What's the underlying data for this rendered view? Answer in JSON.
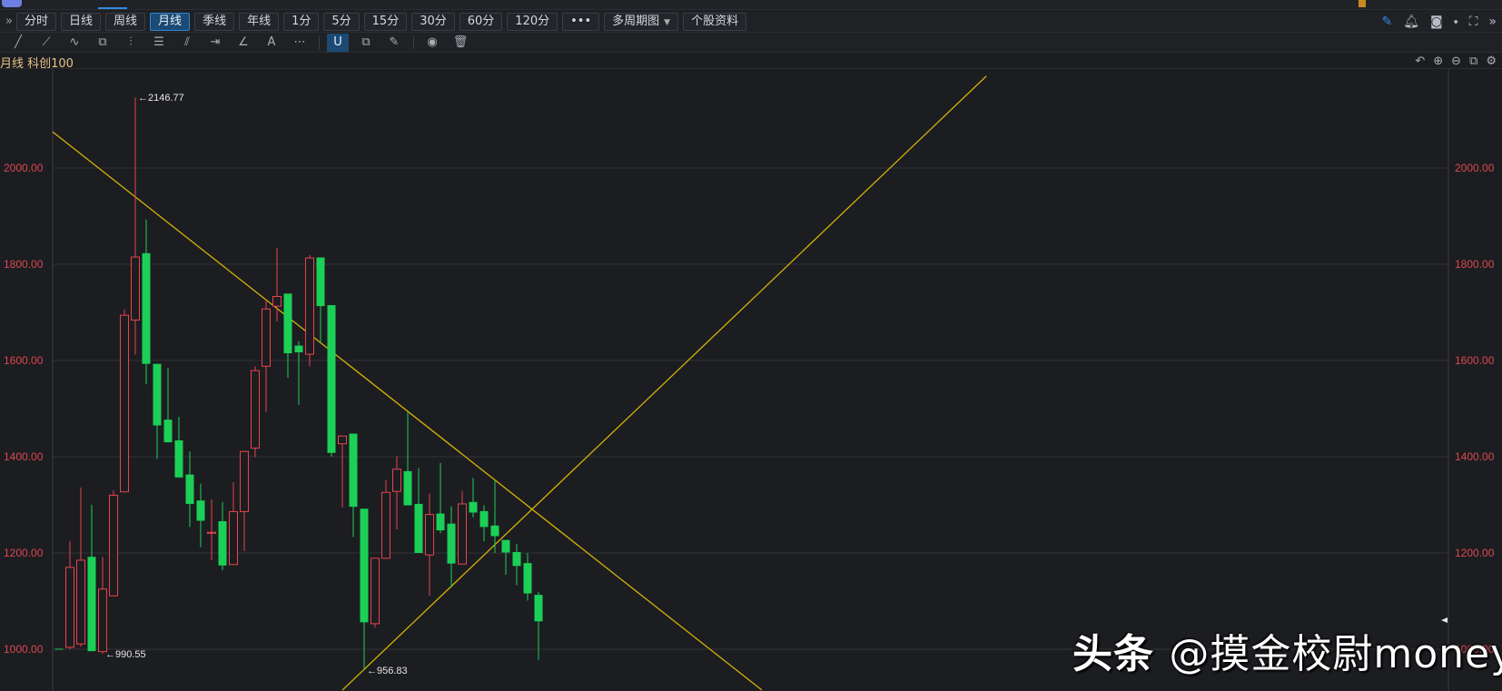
{
  "toolbar": {
    "periods": [
      "分时",
      "日线",
      "周线",
      "月线",
      "季线",
      "年线",
      "1分",
      "5分",
      "15分",
      "30分",
      "60分",
      "120分"
    ],
    "active_period": "月线",
    "more_label": "•••",
    "multi_period_label": "多周期图",
    "stock_info_label": "个股资料"
  },
  "chart_header": {
    "title": "月线 科创100"
  },
  "watermark": {
    "brand": "头条",
    "handle": "@摸金校尉money"
  },
  "colors": {
    "up": "#e8434a",
    "down": "#1ccf56",
    "trendline": "#d4b106",
    "axis_text": "#d8494f",
    "grid": "#303236"
  },
  "chart_data": {
    "type": "candlestick",
    "title": "月线 科创100",
    "ylim": [
      900,
      2200
    ],
    "yticks": [
      1000,
      1200,
      1400,
      1600,
      1800,
      2000
    ],
    "ytick_labels": [
      "1000.00",
      "1200.00",
      "1400.00",
      "1600.00",
      "1800.00",
      "2000.00"
    ],
    "candles_ohlc": [
      [
        1001,
        1001,
        999,
        1000
      ],
      [
        1004,
        1225,
        1000,
        1170
      ],
      [
        1011,
        1336,
        1005,
        1185
      ],
      [
        1192,
        1300,
        996,
        996
      ],
      [
        995,
        1192,
        990.55,
        1125
      ],
      [
        1111,
        1330,
        1111,
        1320
      ],
      [
        1327,
        1706,
        1327,
        1694
      ],
      [
        1684,
        2146.77,
        1612,
        1815
      ],
      [
        1823,
        1893,
        1551,
        1593
      ],
      [
        1593,
        1593,
        1395,
        1465
      ],
      [
        1477,
        1584,
        1430,
        1430
      ],
      [
        1434,
        1483,
        1357,
        1357
      ],
      [
        1363,
        1411,
        1254,
        1302
      ],
      [
        1309,
        1344,
        1212,
        1267
      ],
      [
        1241,
        1311,
        1185,
        1243
      ],
      [
        1266,
        1306,
        1164,
        1174
      ],
      [
        1176,
        1347,
        1176,
        1286
      ],
      [
        1286,
        1411,
        1204,
        1411
      ],
      [
        1418,
        1588,
        1399,
        1579
      ],
      [
        1588,
        1726,
        1493,
        1707
      ],
      [
        1713,
        1834,
        1681,
        1733
      ],
      [
        1739,
        1739,
        1564,
        1615
      ],
      [
        1631,
        1640,
        1508,
        1617
      ],
      [
        1613,
        1819,
        1588,
        1813
      ],
      [
        1814,
        1814,
        1637,
        1713
      ],
      [
        1715,
        1715,
        1400,
        1408
      ],
      [
        1427,
        1443,
        1295,
        1443
      ],
      [
        1448,
        1448,
        1233,
        1296
      ],
      [
        1292,
        1292,
        956.83,
        1056
      ],
      [
        1053,
        1189,
        1045,
        1189
      ],
      [
        1189,
        1352,
        1188,
        1326
      ],
      [
        1328,
        1401,
        1249,
        1374
      ],
      [
        1370,
        1494,
        1299,
        1299
      ],
      [
        1302,
        1376,
        1200,
        1200
      ],
      [
        1196,
        1323,
        1111,
        1280
      ],
      [
        1282,
        1387,
        1241,
        1247
      ],
      [
        1261,
        1297,
        1128,
        1178
      ],
      [
        1177,
        1329,
        1177,
        1302
      ],
      [
        1306,
        1356,
        1274,
        1284
      ],
      [
        1287,
        1299,
        1224,
        1254
      ],
      [
        1257,
        1351,
        1200,
        1235
      ],
      [
        1227,
        1227,
        1155,
        1201
      ],
      [
        1202,
        1219,
        1133,
        1173
      ],
      [
        1179,
        1200,
        1101,
        1116
      ],
      [
        1113,
        1119,
        978,
        1058
      ]
    ],
    "annotations": [
      {
        "label": "←2146.77",
        "candle": 8,
        "price": 2146.77
      },
      {
        "label": "←990.55",
        "candle": 5,
        "price": 990.55
      },
      {
        "label": "←956.83",
        "candle": 29,
        "price": 956.83
      }
    ],
    "trendlines": [
      {
        "from": [
          0.42,
          2075
        ],
        "to": [
          65.5,
          915
        ]
      },
      {
        "from": [
          27.0,
          915
        ],
        "to": [
          86.1,
          2191
        ]
      }
    ]
  }
}
